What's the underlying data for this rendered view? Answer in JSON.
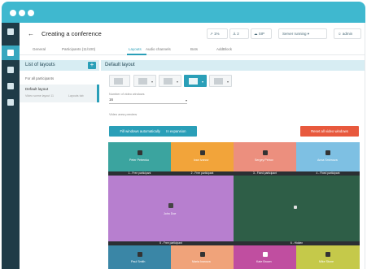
{
  "header": {
    "back_icon": "arrow-left-icon",
    "title": "Creating a conference",
    "buttons": [
      {
        "label": "↗ 1%"
      },
      {
        "label": "⚓ 2"
      },
      {
        "label": "☁ SIP"
      },
      {
        "label": "Server running ▾"
      },
      {
        "label": "☺ admin"
      }
    ]
  },
  "tabs": [
    {
      "label": "General"
    },
    {
      "label": "Participants (11/100)"
    },
    {
      "label": "Layouts",
      "active": true
    },
    {
      "label": "Audio channels"
    },
    {
      "label": "Bots"
    },
    {
      "label": "AddBlock"
    }
  ],
  "sidebar": {
    "title": "List of layouts",
    "add_label": "+",
    "items": [
      {
        "label": "For all participants"
      },
      {
        "label": "Default layout"
      },
      {
        "label": "Video scene layout 11"
      },
      {
        "label": "Layouts tab"
      }
    ]
  },
  "main": {
    "title": "Default layout",
    "select_label": "Number of video windows",
    "select_value": "16",
    "video_label": "Video area preview",
    "fill_button": "Fill windows automatically",
    "fill_mode": "In expansion",
    "reset_button": "Reset all video windows",
    "cells": [
      {
        "name": "Peter Petrenko",
        "caption": "1 - Free participant"
      },
      {
        "name": "Ivan Ivanov",
        "caption": "2 - Free participant"
      },
      {
        "name": "Sergey Petrov",
        "caption": "3 - Fixed participant"
      },
      {
        "name": "Anna Smirnova",
        "caption": "4 - Fixed participant"
      },
      {
        "name": "John Doe",
        "caption": "5 - Free participant"
      },
      {
        "name": "",
        "caption": "6 - Hidden"
      },
      {
        "name": "Paul Smith",
        "caption": ""
      },
      {
        "name": "Maria Ivanova",
        "caption": ""
      },
      {
        "name": "Kate Brown",
        "caption": ""
      },
      {
        "name": "Mike Stone",
        "caption": ""
      }
    ]
  },
  "colors": {
    "accent": "#2a9fb8",
    "titlebar": "#3fb8cf",
    "nav": "#1f3b47",
    "reset": "#e8593d",
    "tile_teal": "#3ba49f",
    "tile_orange": "#f2a43a",
    "tile_salmon": "#ec8f7e",
    "tile_sky": "#7ec0e3",
    "tile_purple": "#b77fcf",
    "tile_dark_green": "#2e5e47"
  }
}
